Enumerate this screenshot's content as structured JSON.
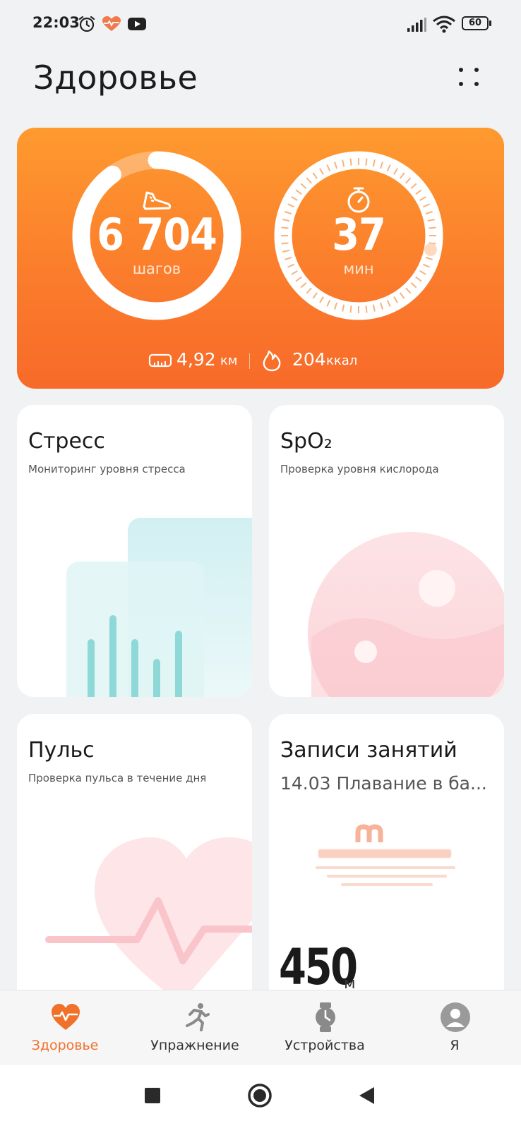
{
  "status_bar": {
    "time": "22:03",
    "battery": "60",
    "icons": [
      "alarm-icon",
      "health-heart-icon",
      "youtube-icon",
      "signal-icon",
      "wifi-icon",
      "battery-icon"
    ]
  },
  "header": {
    "title": "Здоровье",
    "more_icon": "dots-grid-icon"
  },
  "activity": {
    "steps_value": "6 704",
    "steps_unit": "шагов",
    "steps_progress": 0.9,
    "minutes_value": "37",
    "minutes_unit": "мин",
    "distance_value": "4,92",
    "distance_unit": "км",
    "calories_value": "204",
    "calories_unit": "ккал",
    "colors": {
      "card_top": "#fe9a2f",
      "card_bottom": "#f76a29"
    }
  },
  "cards": {
    "stress": {
      "title": "Стресс",
      "subtitle": "Мониторинг уровня стресса"
    },
    "spo2": {
      "title": "SpO₂",
      "subtitle": "Проверка уровня кислорода"
    },
    "pulse": {
      "title": "Пульс",
      "subtitle": "Проверка пульса в течение дня"
    },
    "workouts": {
      "title": "Записи занятий",
      "subtitle": "14.03 Плавание в ба...",
      "value": "450",
      "unit": "м"
    }
  },
  "bottom_nav": {
    "items": [
      {
        "label": "Здоровье",
        "icon": "heart-pulse-icon",
        "active": true
      },
      {
        "label": "Упражнение",
        "icon": "running-icon",
        "active": false
      },
      {
        "label": "Устройства",
        "icon": "watch-icon",
        "active": false
      },
      {
        "label": "Я",
        "icon": "profile-icon",
        "active": false
      }
    ],
    "accent": "#f0712a"
  },
  "system_nav": {
    "icons": [
      "recents-square-icon",
      "home-circle-icon",
      "back-triangle-icon"
    ]
  }
}
